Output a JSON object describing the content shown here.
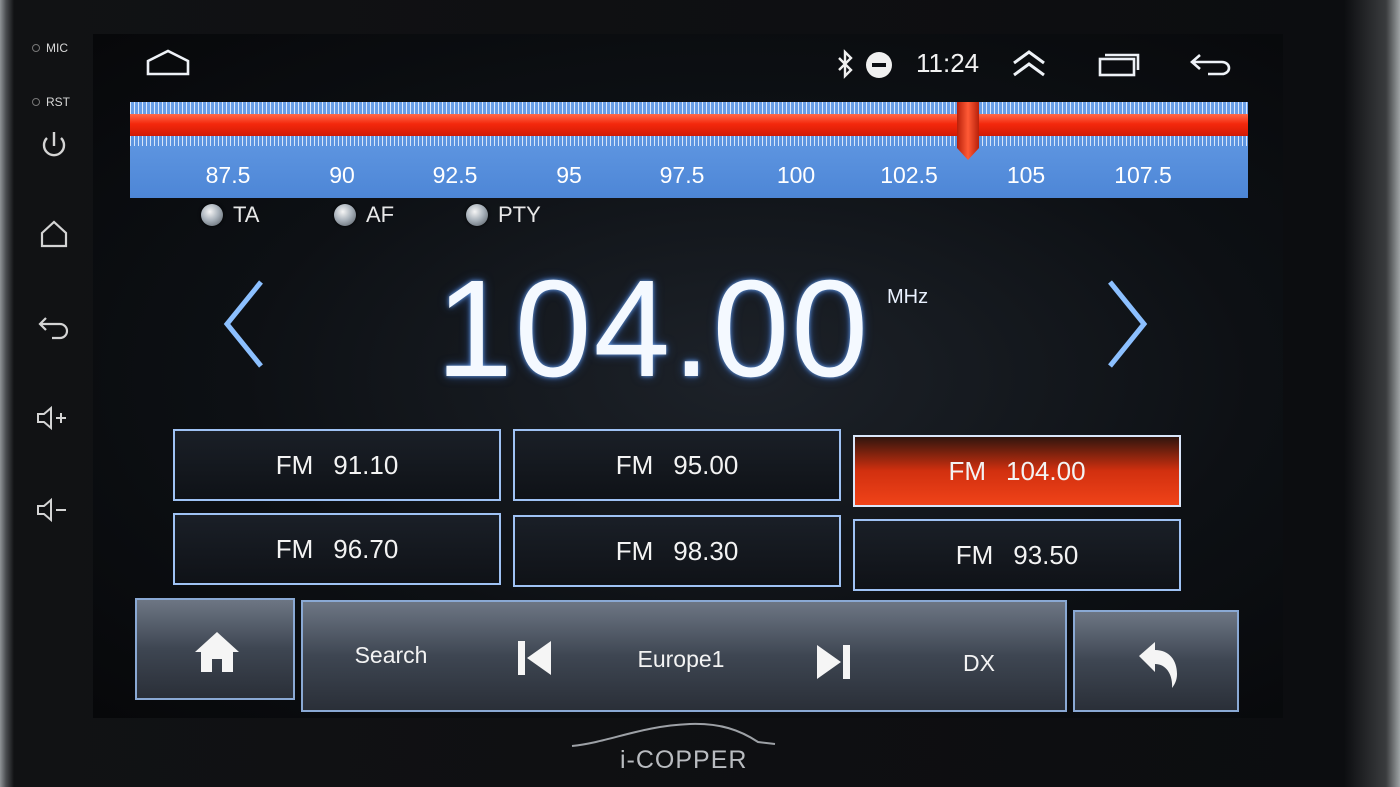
{
  "device": {
    "side_labels": [
      "MIC",
      "RST"
    ],
    "brand_text": "i-COPPER"
  },
  "status_bar": {
    "time": "11:24",
    "icons": [
      "home-outline-icon",
      "bluetooth-icon",
      "do-not-disturb-icon",
      "expand-up-icon",
      "recent-apps-icon",
      "back-icon"
    ]
  },
  "side_buttons": [
    "power-icon",
    "home-icon",
    "back-icon",
    "volume-up-icon",
    "volume-down-icon"
  ],
  "tuner": {
    "scale_labels": [
      "87.5",
      "90",
      "92.5",
      "95",
      "97.5",
      "100",
      "102.5",
      "105",
      "107.5"
    ],
    "scale_min": 87.5,
    "scale_max": 107.5,
    "current_frequency_value": 104.0
  },
  "options": [
    {
      "label": "TA"
    },
    {
      "label": "AF"
    },
    {
      "label": "PTY"
    }
  ],
  "display": {
    "frequency": "104.00",
    "unit": "MHz"
  },
  "presets": [
    {
      "band": "FM",
      "freq": "91.10",
      "active": false
    },
    {
      "band": "FM",
      "freq": "95.00",
      "active": false
    },
    {
      "band": "FM",
      "freq": "104.00",
      "active": true
    },
    {
      "band": "FM",
      "freq": "96.70",
      "active": false
    },
    {
      "band": "FM",
      "freq": "98.30",
      "active": false
    },
    {
      "band": "FM",
      "freq": "93.50",
      "active": false
    }
  ],
  "control_bar": {
    "search_label": "Search",
    "region_label": "Europe1",
    "dx_label": "DX"
  },
  "colors": {
    "accent_red": "#f4280c",
    "dial_blue": "#4d86d6",
    "border_blue": "#9fc2f4"
  }
}
